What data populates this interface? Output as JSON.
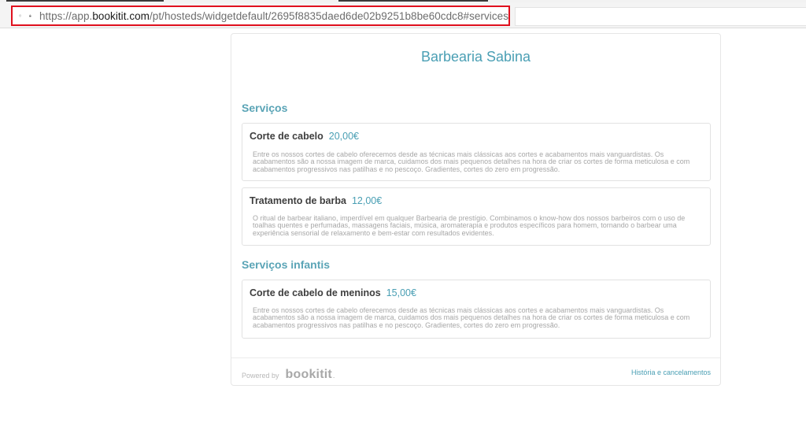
{
  "browser": {
    "url_prefix": "https://app.",
    "url_domain": "bookitit.com",
    "url_path": "/pt/hosteds/widgetdefault/2695f8835daed6de02b9251b8be60cdc8#services",
    "icons": [
      "shield-icon",
      "lock-icon"
    ],
    "highlight_color": "#e0101e"
  },
  "widget": {
    "business_name": "Barbearia Sabina",
    "accent_color": "#4a9fb4",
    "sections": [
      {
        "title": "Serviços",
        "services": [
          {
            "name": "Corte de cabelo",
            "price": "20,00€",
            "description": "Entre os nossos cortes de cabelo oferecemos desde as técnicas mais clássicas aos cortes e acabamentos mais vanguardistas. Os acabamentos são a nossa imagem de marca, cuidamos dos mais pequenos detalhes na hora de criar os cortes de forma meticulosa e com acabamentos progressivos nas patilhas e no pescoço. Gradientes, cortes do zero em progressão."
          },
          {
            "name": "Tratamento de barba",
            "price": "12,00€",
            "description": "O ritual de barbear italiano, imperdível em qualquer Barbearia de prestígio. Combinamos o know-how dos nossos barbeiros com o uso de toalhas quentes e perfumadas, massagens faciais, música, aromaterapia e produtos específicos para homem, tornando o barbear uma experiência sensorial de relaxamento e bem-estar com resultados evidentes."
          }
        ]
      },
      {
        "title": "Serviços infantis",
        "services": [
          {
            "name": "Corte de cabelo de meninos",
            "price": "15,00€",
            "description": "Entre os nossos cortes de cabelo oferecemos desde as técnicas mais clássicas aos cortes e acabamentos mais vanguardistas. Os acabamentos são a nossa imagem de marca, cuidamos dos mais pequenos detalhes na hora de criar os cortes de forma meticulosa e com acabamentos progressivos nas patilhas e no pescoço. Gradientes, cortes do zero em progressão."
          }
        ]
      }
    ],
    "footer": {
      "powered_by": "Powered by",
      "logo_text": "bookitit",
      "logo_suffix": ".",
      "link_label": "História e cancelamentos"
    }
  }
}
